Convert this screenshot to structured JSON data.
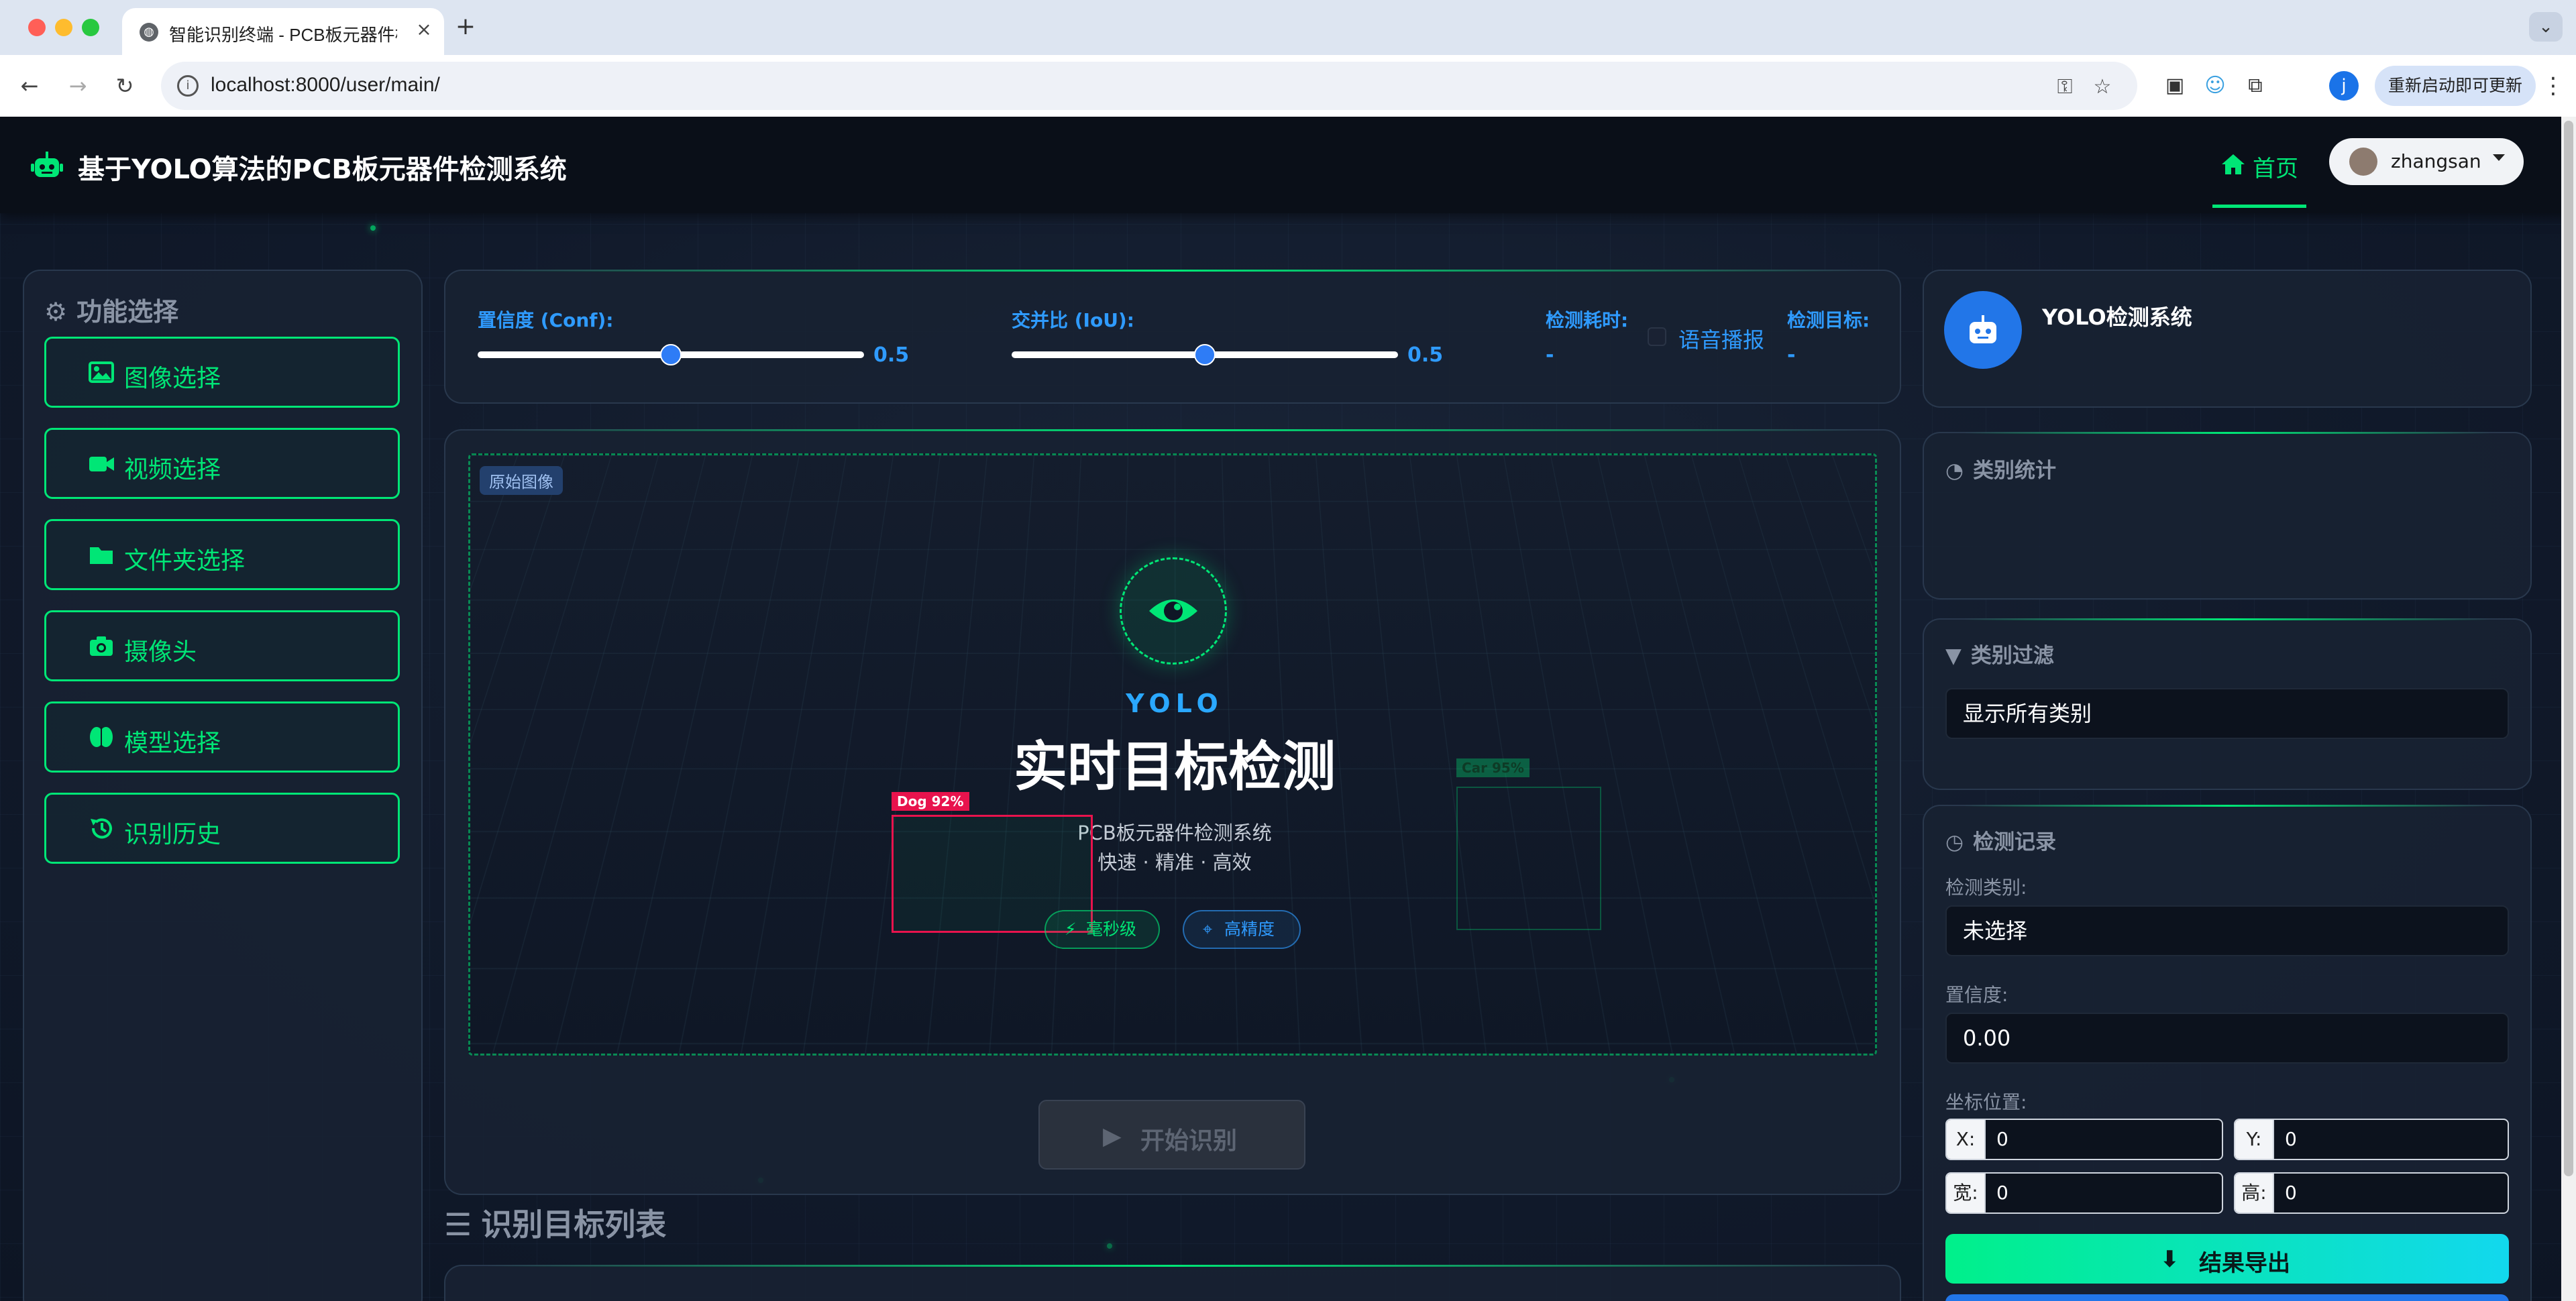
{
  "browser": {
    "tab_title": "智能识别终端 - PCB板元器件检测系统",
    "url": "localhost:8000/user/main/",
    "update_label": "重新启动即可更新",
    "profile_initial": "j"
  },
  "header": {
    "title": "基于YOLO算法的PCB板元器件检测系统",
    "home_label": "首页",
    "username": "zhangsan",
    "accent": "#00e676"
  },
  "sidebar": {
    "title": "功能选择",
    "items": [
      {
        "label": "图像选择",
        "icon": "image-icon"
      },
      {
        "label": "视频选择",
        "icon": "video-icon"
      },
      {
        "label": "文件夹选择",
        "icon": "folder-icon"
      },
      {
        "label": "摄像头",
        "icon": "camera-icon"
      },
      {
        "label": "模型选择",
        "icon": "brain-icon"
      },
      {
        "label": "识别历史",
        "icon": "history-icon"
      }
    ]
  },
  "params": {
    "conf_label": "置信度 (Conf):",
    "conf_value": "0.5",
    "conf_level": 0.5,
    "iou_label": "交并比 (IoU):",
    "iou_value": "0.5",
    "iou_level": 0.5,
    "time_label": "检测耗时:",
    "time_value": "-",
    "voice_label": "语音播报",
    "target_label": "检测目标:",
    "target_value": "-"
  },
  "stage": {
    "badge": "原始图像",
    "brand": "YOLO",
    "title": "实时目标检测",
    "subtitle": "PCB板元器件检测系统",
    "tagline": "快速 · 精准 · 高效",
    "pill_speed": "毫秒级",
    "pill_precision": "高精度",
    "det_dog": "Dog 92%",
    "det_car": "Car 95%"
  },
  "actions": {
    "start_label": "开始识别",
    "list_title": "识别目标列表"
  },
  "right": {
    "system_name": "YOLO检测系统",
    "stats_title": "类别统计",
    "filter_title": "类别过滤",
    "filter_value": "显示所有类别",
    "record_title": "检测记录",
    "class_label": "检测类别:",
    "class_value": "未选择",
    "conf_label": "置信度:",
    "conf_value": "0.00",
    "coord_label": "坐标位置:",
    "x_label": "X:",
    "x_value": "0",
    "y_label": "Y:",
    "y_value": "0",
    "w_label": "宽:",
    "w_value": "0",
    "h_label": "高:",
    "h_value": "0",
    "export_label": "结果导出"
  }
}
